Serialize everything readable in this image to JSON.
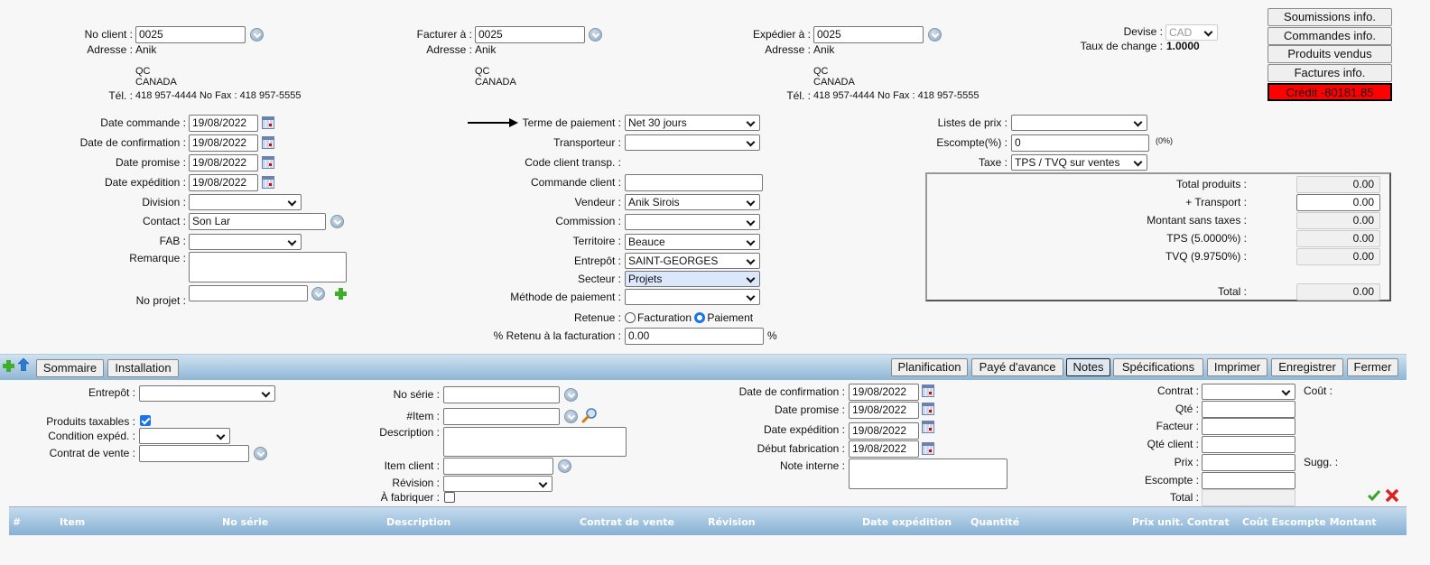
{
  "client": {
    "no_label": "No client :",
    "no": "0025",
    "adresse_label": "Adresse :",
    "adresse": "Anik",
    "province": "QC",
    "pays": "CANADA",
    "tel_label": "Tél. :",
    "tel": "418 957-4444 No Fax : 418 957-5555"
  },
  "facturer": {
    "label": "Facturer à :",
    "no": "0025",
    "adresse_label": "Adresse :",
    "adresse": "Anik",
    "province": "QC",
    "pays": "CANADA"
  },
  "expedier": {
    "label": "Expédier à :",
    "no": "0025",
    "adresse_label": "Adresse :",
    "adresse": "Anik",
    "province": "QC",
    "pays": "CANADA",
    "tel_label": "Tél. :",
    "tel": "418 957-4444 No Fax : 418 957-5555"
  },
  "devise": {
    "label": "Devise :",
    "value": "CAD",
    "taux_label": "Taux de change :",
    "taux": "1.0000"
  },
  "side_buttons": [
    "Soumissions info.",
    "Commandes info.",
    "Produits vendus",
    "Factures info.",
    "Crédit -80181.85"
  ],
  "credit_color": "#ff0000",
  "left": {
    "date_commande_label": "Date commande :",
    "date_commande": "19/08/2022",
    "date_confirmation_label": "Date de confirmation :",
    "date_confirmation": "19/08/2022",
    "date_promise_label": "Date promise :",
    "date_promise": "19/08/2022",
    "date_expedition_label": "Date expédition :",
    "date_expedition": "19/08/2022",
    "division_label": "Division :",
    "contact_label": "Contact :",
    "contact": "Son Lar",
    "fab_label": "FAB :",
    "remarque_label": "Remarque :",
    "no_projet_label": "No projet :"
  },
  "middle": {
    "terme_label": "Terme de paiement :",
    "terme": "Net 30 jours",
    "transporteur_label": "Transporteur :",
    "code_transp_label": "Code client transp. :",
    "commande_client_label": "Commande client :",
    "vendeur_label": "Vendeur :",
    "vendeur": "Anik Sirois",
    "commission_label": "Commission :",
    "territoire_label": "Territoire :",
    "territoire": "Beauce",
    "entrepot_label": "Entrepôt :",
    "entrepot": "SAINT-GEORGES",
    "secteur_label": "Secteur :",
    "secteur": "Projets",
    "methode_label": "Méthode de paiement :",
    "retenue_label": "Retenue :",
    "retenue_options": [
      "Facturation",
      "Paiement"
    ],
    "retenue_selected": "Paiement",
    "pct_retenu_label": "% Retenu à la facturation :",
    "pct_retenu": "0.00",
    "pct_sign": "%"
  },
  "right": {
    "listes_prix_label": "Listes de prix :",
    "escompte_label": "Escompte(%) :",
    "escompte": "0",
    "escompte_note": "(0%)",
    "taxe_label": "Taxe :",
    "taxe": "TPS / TVQ sur ventes"
  },
  "totals": [
    {
      "label": "Total produits :",
      "value": "0.00"
    },
    {
      "label": "+ Transport :",
      "value": "0.00"
    },
    {
      "label": "Montant sans taxes :",
      "value": "0.00"
    },
    {
      "label": "TPS (5.0000%) :",
      "value": "0.00"
    },
    {
      "label": "TVQ (9.9750%) :",
      "value": "0.00"
    },
    {
      "label": "Total :",
      "value": "0.00"
    }
  ],
  "toolbar": {
    "left": [
      "Sommaire",
      "Installation"
    ],
    "right": [
      "Planification",
      "Payé d'avance",
      "Notes",
      "Spécifications",
      "Imprimer",
      "Enregistrer",
      "Fermer"
    ],
    "active": "Notes"
  },
  "line": {
    "entrepot_label": "Entrepôt :",
    "taxables_label": "Produits taxables :",
    "taxables": true,
    "condition_label": "Condition expéd. :",
    "contrat_vente_label": "Contrat de vente :",
    "no_serie_label": "No série :",
    "item_label": "#Item :",
    "description_label": "Description :",
    "item_client_label": "Item client :",
    "revision_label": "Révision :",
    "a_fabriquer_label": "À fabriquer :",
    "a_fabriquer": false,
    "date_confirmation_label": "Date de confirmation :",
    "date_confirmation": "19/08/2022",
    "date_promise_label": "Date promise :",
    "date_promise": "19/08/2022",
    "date_expedition_label": "Date expédition :",
    "date_expedition": "19/08/2022",
    "debut_fab_label": "Début fabrication :",
    "debut_fab": "19/08/2022",
    "note_interne_label": "Note interne :",
    "contrat_label": "Contrat :",
    "cout_label": "Coût :",
    "qte_label": "Qté :",
    "facteur_label": "Facteur :",
    "qte_client_label": "Qté client :",
    "prix_label": "Prix :",
    "sugg_label": "Sugg. :",
    "escompte_label": "Escompte :",
    "total_label": "Total :"
  },
  "table": {
    "headers": [
      "#",
      "Item",
      "No série",
      "Description",
      "Contrat de vente",
      "Révision",
      "Date expédition",
      "Quantité",
      "Prix unit. Contrat",
      "Coût Escompte Montant"
    ]
  }
}
